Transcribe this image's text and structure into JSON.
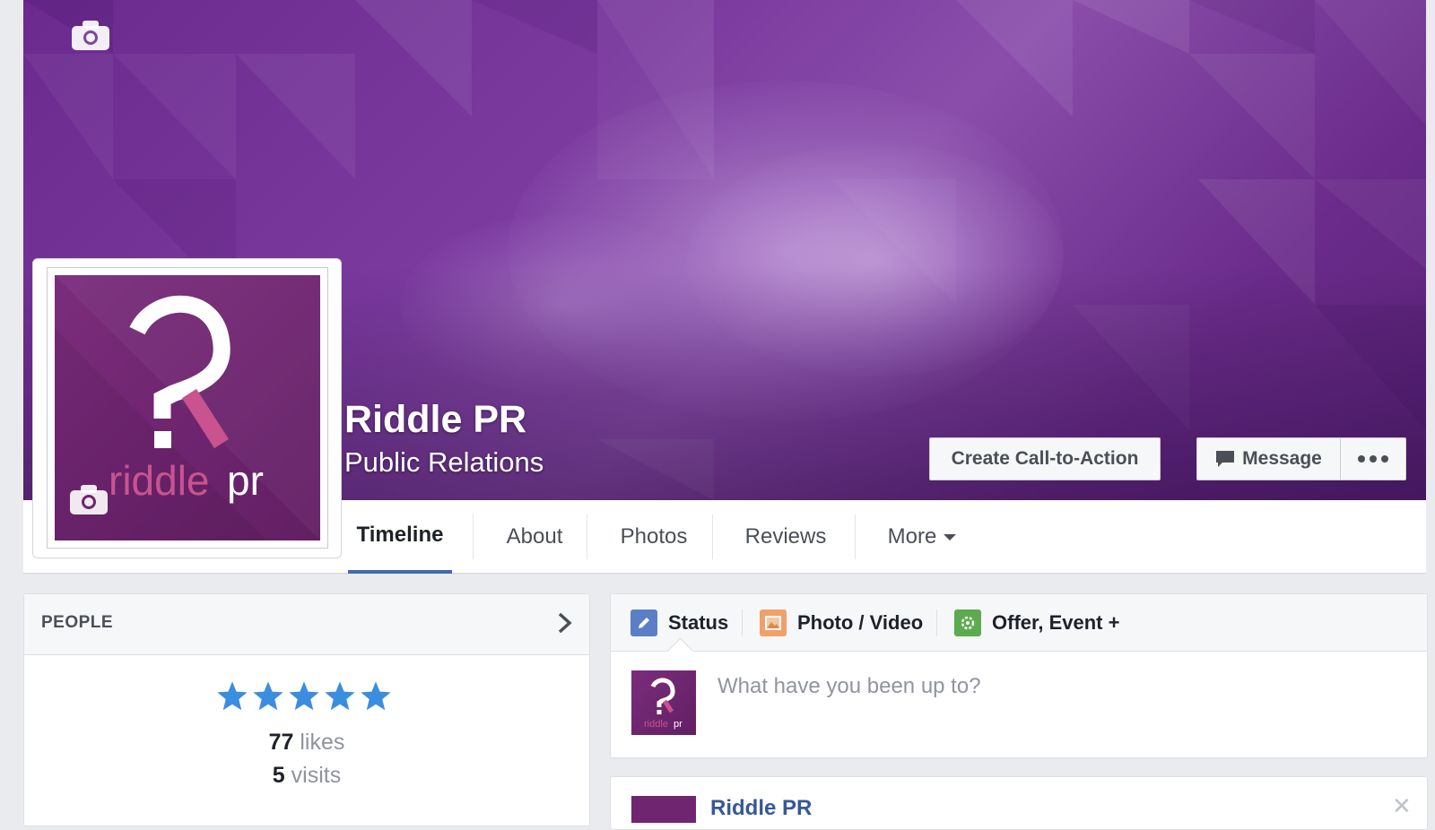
{
  "page": {
    "name": "Riddle PR",
    "category": "Public Relations",
    "logo_text": "riddle pr"
  },
  "actions": {
    "cta": "Create Call-to-Action",
    "message": "Message"
  },
  "nav": {
    "tabs": [
      {
        "label": "Timeline",
        "active": true
      },
      {
        "label": "About"
      },
      {
        "label": "Photos"
      },
      {
        "label": "Reviews"
      },
      {
        "label": "More"
      }
    ]
  },
  "people": {
    "title": "PEOPLE",
    "rating_stars": 5,
    "likes_count": "77",
    "likes_label": "likes",
    "visits_count": "5",
    "visits_label": "visits"
  },
  "composer": {
    "tabs": [
      {
        "label": "Status",
        "icon": "pencil-icon"
      },
      {
        "label": "Photo / Video",
        "icon": "photo-icon"
      },
      {
        "label": "Offer, Event +",
        "icon": "offer-icon"
      }
    ],
    "placeholder": "What have you been up to?"
  },
  "post": {
    "author": "Riddle PR"
  },
  "colors": {
    "brand_purple": "#6f2570",
    "accent_pink": "#c9538f",
    "fb_blue": "#4267b2",
    "star_blue": "#3b8de0"
  }
}
